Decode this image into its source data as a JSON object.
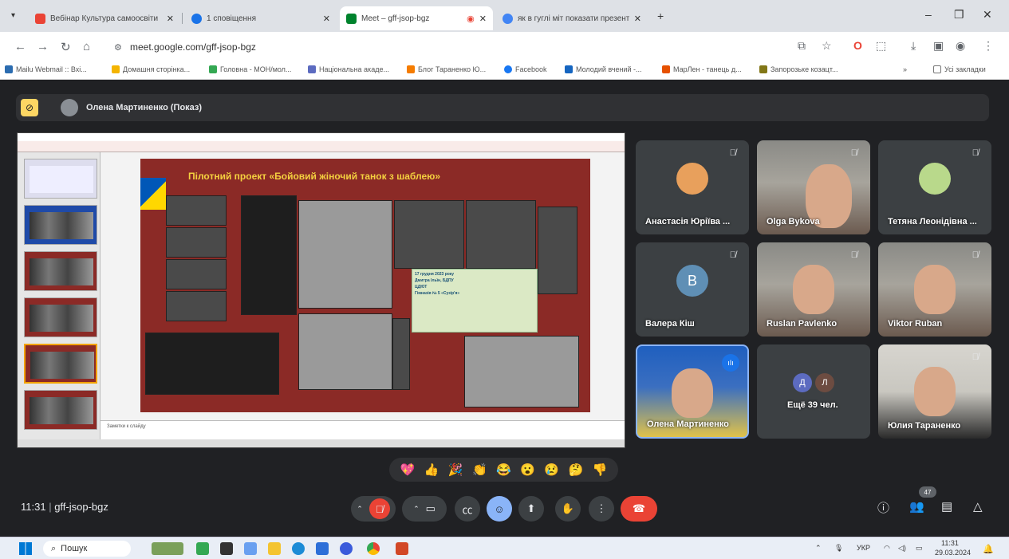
{
  "browser": {
    "tabs": [
      {
        "label": "Вебінар Культура самоосвіти",
        "color": "#ea4335"
      },
      {
        "label": "1 сповіщення",
        "color": "#1a73e8"
      },
      {
        "label": "Meet – gff-jsop-bgz",
        "color": "#00832d"
      },
      {
        "label": "як в гуглі міт показати презент",
        "color": "#4285f4"
      }
    ],
    "url": "meet.google.com/gff-jsop-bgz",
    "bookmarks": [
      {
        "label": "Mailu Webmail :: Вхі...",
        "color": "#2b6cb0"
      },
      {
        "label": "Домашня сторінка...",
        "color": "#f4b400"
      },
      {
        "label": "Головна - МОН/мол...",
        "color": "#34a853"
      },
      {
        "label": "Національна акаде...",
        "color": "#5c6bc0"
      },
      {
        "label": "Блог Тараненко Ю...",
        "color": "#f57c00"
      },
      {
        "label": "Facebook",
        "color": "#1877f2"
      },
      {
        "label": "Молодий вчений -...",
        "color": "#1565c0"
      },
      {
        "label": "МарЛен - танець д...",
        "color": "#e65100"
      },
      {
        "label": "Запорозьке козацт...",
        "color": "#827717"
      }
    ],
    "all_bookmarks": "Усі закладки",
    "chevron": "»"
  },
  "meet": {
    "presenter_label": "Олена Мартиненко (Показ)",
    "slide": {
      "title": "Пілотний проект «Бойовий жіночий танок з шаблею»",
      "poster_lines": [
        "17 грудня 2023 року",
        "Дмитра Ільїн, БДПУ",
        "ЦДЮТ",
        "Гімназія № 5 «Сузір'я»"
      ],
      "notes": "Заметки к слайду"
    },
    "participants": [
      {
        "name": "Анастасія Юріїва ...",
        "muted": true,
        "kind": "photo-avatar",
        "color": "#e8a05c"
      },
      {
        "name": "Olga Bykova",
        "muted": true,
        "kind": "video"
      },
      {
        "name": "Тетяна Леонідівна ...",
        "muted": true,
        "kind": "photo-avatar",
        "color": "#b9d98b"
      },
      {
        "name": "Валера Кіш",
        "muted": true,
        "kind": "letter",
        "letter": "В",
        "color": "#5f8fb5"
      },
      {
        "name": "Ruslan Pavlenko",
        "muted": true,
        "kind": "video"
      },
      {
        "name": "Viktor Ruban",
        "muted": true,
        "kind": "video"
      },
      {
        "name": "Олена Мартиненко",
        "muted": false,
        "kind": "video",
        "speaking": true
      },
      {
        "name": "Ещё 39 чел.",
        "muted": false,
        "kind": "more",
        "letters": [
          "Д",
          "Л"
        ]
      },
      {
        "name": "Юлия Тараненко",
        "muted": true,
        "kind": "video"
      }
    ],
    "reactions": [
      "💖",
      "👍",
      "🎉",
      "👏",
      "😂",
      "😮",
      "😢",
      "🤔",
      "👎"
    ],
    "time": "11:31",
    "meeting_code": "gff-jsop-bgz",
    "people_count": "47"
  },
  "taskbar": {
    "search": "Пошук",
    "lang": "УКР",
    "time": "11:31",
    "date": "29.03.2024"
  }
}
